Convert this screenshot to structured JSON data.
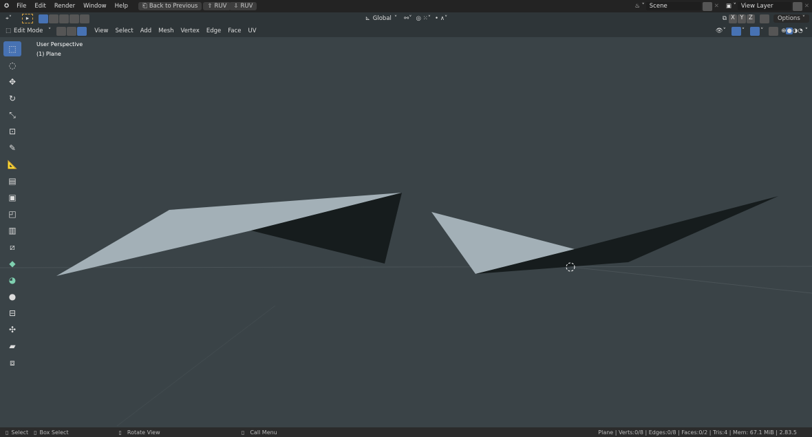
{
  "topbar": {
    "menus": [
      "File",
      "Edit",
      "Render",
      "Window",
      "Help"
    ],
    "back": "Back to Previous",
    "ruv_up": "RUV",
    "ruv_down": "RUV",
    "scene": "Scene",
    "view_layer": "View Layer"
  },
  "header1": {
    "orientation": "Global",
    "axes": [
      "X",
      "Y",
      "Z"
    ],
    "options": "Options"
  },
  "header2": {
    "mode": "Edit Mode",
    "menus": [
      "View",
      "Select",
      "Add",
      "Mesh",
      "Vertex",
      "Edge",
      "Face",
      "UV"
    ]
  },
  "viewport": {
    "perspective": "User Perspective",
    "object": "(1) Plane"
  },
  "tools": [
    "select-box",
    "cursor",
    "move",
    "rotate",
    "scale",
    "transform",
    "annotate",
    "measure",
    "extrude",
    "inset",
    "bevel",
    "loop-cut",
    "knife",
    "poly-build",
    "spin",
    "smooth",
    "edge-slide",
    "shrink-fatten",
    "shear"
  ],
  "status": {
    "select": "Select",
    "box_select": "Box Select",
    "rotate": "Rotate View",
    "call_menu": "Call Menu",
    "stats": "Plane | Verts:0/8 | Edges:0/8 | Faces:0/2 | Tris:4 | Mem: 67.1 MiB | 2.83.5"
  },
  "colors": {
    "accent": "#4772b3",
    "light_face": "#a3b0b7",
    "dark_face": "#161c1d"
  }
}
